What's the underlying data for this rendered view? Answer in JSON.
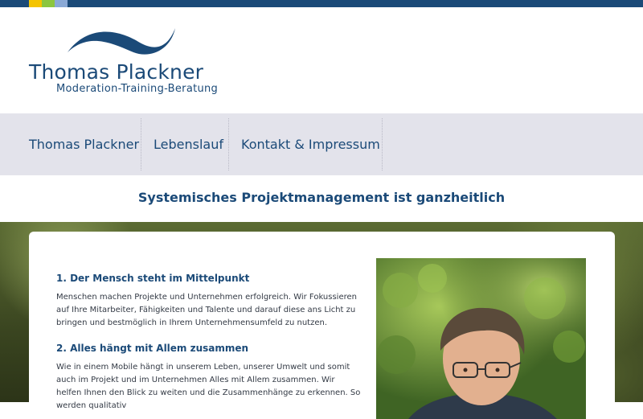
{
  "logo": {
    "name": "Thomas Plackner",
    "tagline": "Moderation-Training-Beratung"
  },
  "nav": {
    "items": [
      {
        "label": "Thomas Plackner"
      },
      {
        "label": "Lebenslauf"
      },
      {
        "label": "Kontakt & Impressum"
      }
    ]
  },
  "page": {
    "title": "Systemisches Projektmanagement ist ganzheitlich"
  },
  "content": {
    "section1": {
      "heading": "1. Der Mensch steht im Mittelpunkt",
      "text": "Menschen machen Projekte und Unternehmen erfolgreich. Wir Fokussieren auf Ihre Mitarbeiter, Fähigkeiten und Talente und darauf diese ans Licht zu bringen und bestmöglich in Ihrem Unternehmensumfeld zu nutzen."
    },
    "section2": {
      "heading": "2. Alles hängt mit Allem zusammen",
      "text": "Wie in einem Mobile hängt in unserem Leben, unserer Umwelt und somit auch im Projekt und im Unternehmen Alles mit Allem zusammen. Wir helfen Ihnen den Blick zu weiten und die Zusammenhänge zu erkennen. So werden qualitativ"
    }
  },
  "colors": {
    "brand": "#1b4a78",
    "nav_bg": "#e3e3eb",
    "accent_yellow": "#f4c400",
    "accent_green": "#8cc63f",
    "accent_blue": "#8aa9d6"
  }
}
